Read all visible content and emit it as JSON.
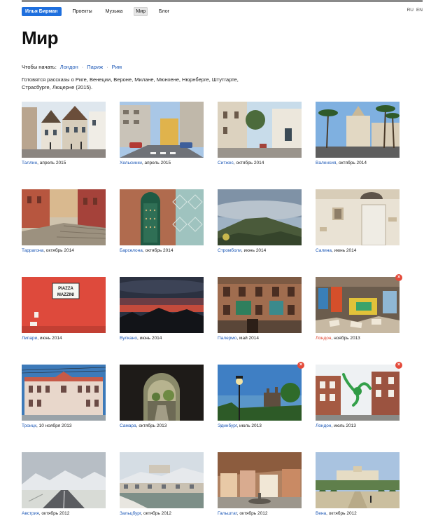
{
  "nav": {
    "brand": "Илья Бирман",
    "items": [
      "Проекты",
      "Музыка",
      "Мир",
      "Блог"
    ],
    "active_index": 2,
    "languages": [
      "RU",
      "EN"
    ]
  },
  "page_title": "Мир",
  "start": {
    "label": "Чтобы начать:",
    "links": [
      "Лондон",
      "Париж",
      "Рим"
    ],
    "separator": "·"
  },
  "intro": "Готовятся рассказы о Риге, Венеции, Вероне, Милане, Мюнхене, Нюрнберге, Штутгарте, Страсбурге, Люцерне (2015).",
  "colors": {
    "accent": "#1e6fde",
    "link": "#1a56b5",
    "new_link": "#e0432f",
    "badge": "#e44a3a"
  },
  "photos": [
    {
      "place": "Таллин",
      "date": ", апрель 2015",
      "scene": "old-town",
      "badge": false
    },
    {
      "place": "Хельсинки",
      "date": ", апрель 2015",
      "scene": "street-sky",
      "badge": false
    },
    {
      "place": "Ситжес",
      "date": ", октябрь 2014",
      "scene": "narrow-street",
      "badge": false
    },
    {
      "place": "Валенсия",
      "date": ", октябрь 2014",
      "scene": "palms",
      "badge": false
    },
    {
      "place": "Таррагона",
      "date": ", октябрь 2014",
      "scene": "stairs",
      "badge": false
    },
    {
      "place": "Барселона",
      "date": ", октябрь 2014",
      "scene": "door",
      "badge": false
    },
    {
      "place": "Стромболи",
      "date": ", июнь 2014",
      "scene": "volcano",
      "badge": false
    },
    {
      "place": "Салина",
      "date": ", июнь 2014",
      "scene": "white-wall",
      "badge": false
    },
    {
      "place": "Липари",
      "date": ", июнь 2014",
      "scene": "red-wall",
      "badge": false,
      "sign": [
        "PIAZZA",
        "MAZZINI"
      ]
    },
    {
      "place": "Вулкано",
      "date": ", июнь 2014",
      "scene": "sunset",
      "badge": false
    },
    {
      "place": "Палермо",
      "date": ", май 2014",
      "scene": "facade",
      "badge": false
    },
    {
      "place": "Лондон",
      "date": ", ноябрь 2013",
      "scene": "graffiti",
      "badge": true
    },
    {
      "place": "Троицк",
      "date": ", 10 ноября 2013",
      "scene": "building",
      "badge": false
    },
    {
      "place": "Самара",
      "date": ", октябрь 2013",
      "scene": "arch",
      "badge": false
    },
    {
      "place": "Эдинбург",
      "date": ", июль 2013",
      "scene": "lamp",
      "badge": true
    },
    {
      "place": "Лондон",
      "date": ", июль 2013",
      "scene": "octopus",
      "badge": true
    },
    {
      "place": "Австрия",
      "date": ", октябрь 2012",
      "scene": "road",
      "badge": false
    },
    {
      "place": "Зальцбург",
      "date": ", октябрь 2012",
      "scene": "river",
      "badge": false
    },
    {
      "place": "Гальштат",
      "date": ", октябрь 2012",
      "scene": "village",
      "badge": false
    },
    {
      "place": "Вена",
      "date": ", октябрь 2012",
      "scene": "palace",
      "badge": false
    }
  ]
}
